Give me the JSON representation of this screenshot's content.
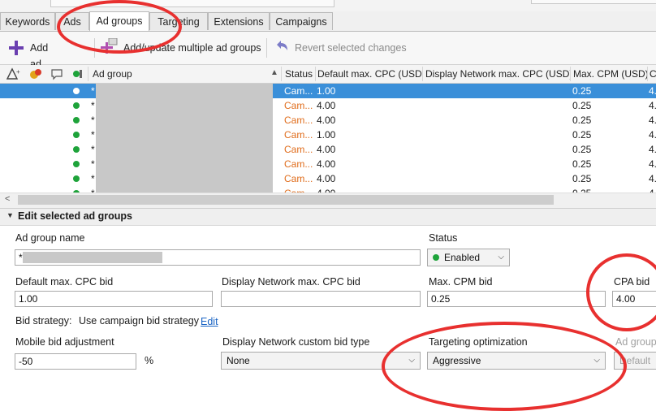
{
  "tabs": [
    {
      "label": "Keywords",
      "active": false
    },
    {
      "label": "Ads",
      "active": false
    },
    {
      "label": "Ad groups",
      "active": true
    },
    {
      "label": "Targeting",
      "active": false
    },
    {
      "label": "Extensions",
      "active": false
    },
    {
      "label": "Campaigns",
      "active": false
    }
  ],
  "toolbar": {
    "add_ad_group": "Add ad group",
    "add_update_multiple": "Add/update multiple ad groups",
    "revert": "Revert selected changes"
  },
  "grid": {
    "columns": {
      "ad_group": "Ad group",
      "status": "Status",
      "default_cpc": "Default max. CPC (USD)",
      "display_cpc": "Display Network max. CPC (USD)",
      "max_cpm": "Max. CPM (USD)",
      "overflow": "C"
    },
    "rows": [
      {
        "name": "*",
        "status": "Cam...",
        "cpc": "1.00",
        "cpm": "0.25",
        "extra": "4.",
        "selected": true
      },
      {
        "name": "*",
        "status": "Cam...",
        "cpc": "4.00",
        "cpm": "0.25",
        "extra": "4.",
        "selected": false
      },
      {
        "name": "*",
        "status": "Cam...",
        "cpc": "4.00",
        "cpm": "0.25",
        "extra": "4.",
        "selected": false
      },
      {
        "name": "*",
        "status": "Cam...",
        "cpc": "1.00",
        "cpm": "0.25",
        "extra": "4.",
        "selected": false
      },
      {
        "name": "*",
        "status": "Cam...",
        "cpc": "4.00",
        "cpm": "0.25",
        "extra": "4.",
        "selected": false
      },
      {
        "name": "*",
        "status": "Cam...",
        "cpc": "4.00",
        "cpm": "0.25",
        "extra": "4.",
        "selected": false
      },
      {
        "name": "*",
        "status": "Cam...",
        "cpc": "4.00",
        "cpm": "0.25",
        "extra": "4.",
        "selected": false
      },
      {
        "name": "*",
        "status": "Cam...",
        "cpc": "4.00",
        "cpm": "0.25",
        "extra": "4.",
        "selected": false
      }
    ]
  },
  "edit": {
    "header": "Edit selected ad groups",
    "ad_group_name_label": "Ad group name",
    "ad_group_name_value": "*",
    "status_label": "Status",
    "status_value": "Enabled",
    "default_cpc_label": "Default max. CPC bid",
    "default_cpc_value": "1.00",
    "display_cpc_label": "Display Network max. CPC bid",
    "display_cpc_value": "",
    "max_cpm_label": "Max. CPM bid",
    "max_cpm_value": "0.25",
    "cpa_label": "CPA bid",
    "cpa_value": "4.00",
    "bid_strategy_label": "Bid strategy:",
    "bid_strategy_value": "Use campaign bid strategy",
    "edit_link": "Edit",
    "mobile_label": "Mobile bid adjustment",
    "mobile_value": "-50",
    "percent": "%",
    "display_custom_label": "Display Network custom bid type",
    "display_custom_value": "None",
    "targeting_label": "Targeting optimization",
    "targeting_value": "Aggressive",
    "ad_group_partial_label": "Ad group",
    "default_partial": "Default"
  },
  "colors": {
    "selected_row": "#3a8fd9",
    "status_text": "#e06d1c",
    "annotation": "#e8302f",
    "enabled_dot": "#1ea33a"
  }
}
